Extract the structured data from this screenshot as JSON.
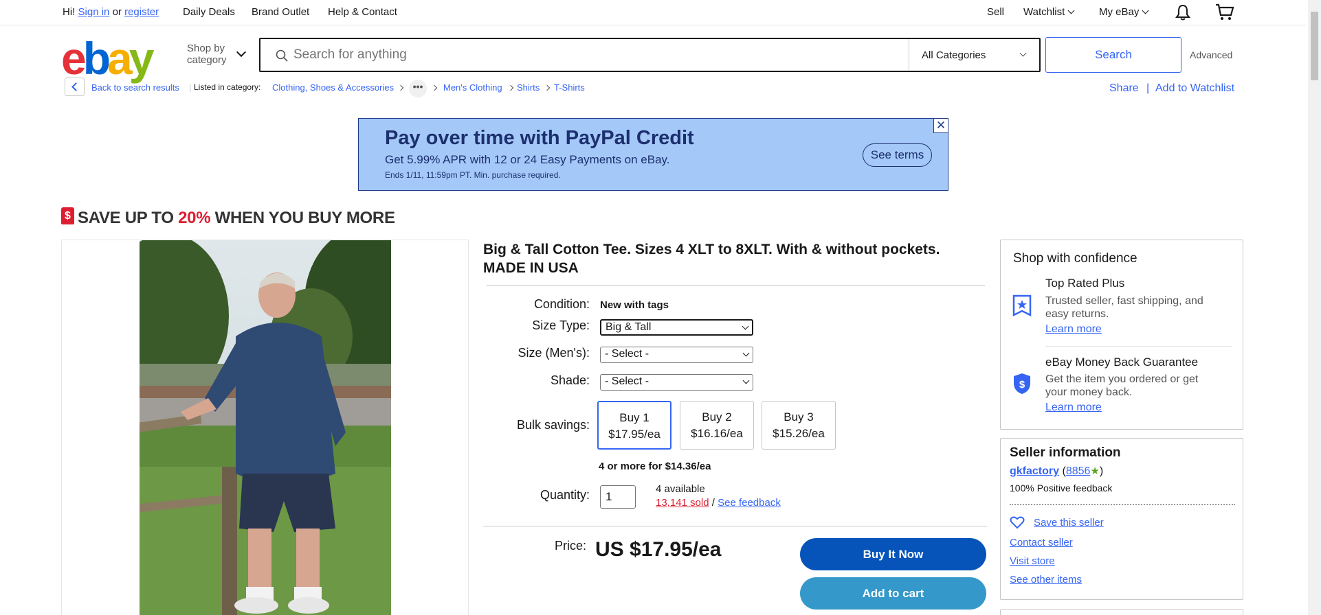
{
  "topnav": {
    "greeting": "Hi!",
    "signin": "Sign in",
    "or": "or",
    "register": "register",
    "daily_deals": "Daily Deals",
    "brand_outlet": "Brand Outlet",
    "help": "Help & Contact",
    "sell": "Sell",
    "watchlist": "Watchlist",
    "my_ebay": "My eBay"
  },
  "header": {
    "shop_by_line1": "Shop by",
    "shop_by_line2": "category",
    "search_placeholder": "Search for anything",
    "category": "All Categories",
    "search_button": "Search",
    "advanced": "Advanced"
  },
  "breadcrumb": {
    "back": "Back to search results",
    "listed_in": "Listed in category:",
    "crumbs": [
      "Clothing, Shoes & Accessories",
      "Men's Clothing",
      "Shirts",
      "T-Shirts"
    ],
    "share": "Share",
    "add_watchlist": "Add to Watchlist"
  },
  "ad": {
    "headline": "Pay over time with PayPal Credit",
    "sub": "Get 5.99% APR with 12 or 24 Easy Payments on eBay.",
    "terms": "Ends 1/11, 11:59pm PT. Min. purchase required.",
    "cta": "See terms"
  },
  "promo": {
    "pre": "SAVE UP TO",
    "pct": "20%",
    "post": "WHEN YOU BUY MORE"
  },
  "product": {
    "title": "Big & Tall Cotton Tee. Sizes 4 XLT to 8XLT. With & without pockets. MADE IN USA",
    "condition_label": "Condition:",
    "condition_value": "New with tags",
    "size_type_label": "Size Type:",
    "size_type_value": "Big & Tall",
    "size_label": "Size (Men's):",
    "size_value": "- Select -",
    "shade_label": "Shade:",
    "shade_value": "- Select -",
    "bulk_label": "Bulk savings:",
    "bulk": [
      {
        "qty": "Buy 1",
        "price": "$17.95/ea"
      },
      {
        "qty": "Buy 2",
        "price": "$16.16/ea"
      },
      {
        "qty": "Buy 3",
        "price": "$15.26/ea"
      }
    ],
    "bulk_more": "4 or more for $14.36/ea",
    "quantity_label": "Quantity:",
    "quantity_value": "1",
    "available": "4 available",
    "sold": "13,141 sold",
    "slash": "/",
    "see_feedback": "See feedback",
    "price_label": "Price:",
    "price": "US $17.95/ea",
    "buy_now": "Buy It Now",
    "add_to_cart": "Add to cart"
  },
  "confidence": {
    "title": "Shop with confidence",
    "items": [
      {
        "title": "Top Rated Plus",
        "text1": "Trusted seller, fast shipping, and",
        "text2": "easy returns.",
        "link": "Learn more"
      },
      {
        "title": "eBay Money Back Guarantee",
        "text1": "Get the item you ordered or get",
        "text2": "your money back.",
        "link": "Learn more"
      }
    ]
  },
  "seller": {
    "title": "Seller information",
    "name": "gkfactory",
    "score": "8856",
    "feedback": "100% Positive feedback",
    "save": "Save this seller",
    "contact": "Contact seller",
    "visit": "Visit store",
    "other": "See other items"
  },
  "colors": {
    "primary_blue": "#3665f3",
    "buy_now": "#0654ba",
    "add_cart": "#3498ca",
    "promo_red": "#dd1e31"
  }
}
